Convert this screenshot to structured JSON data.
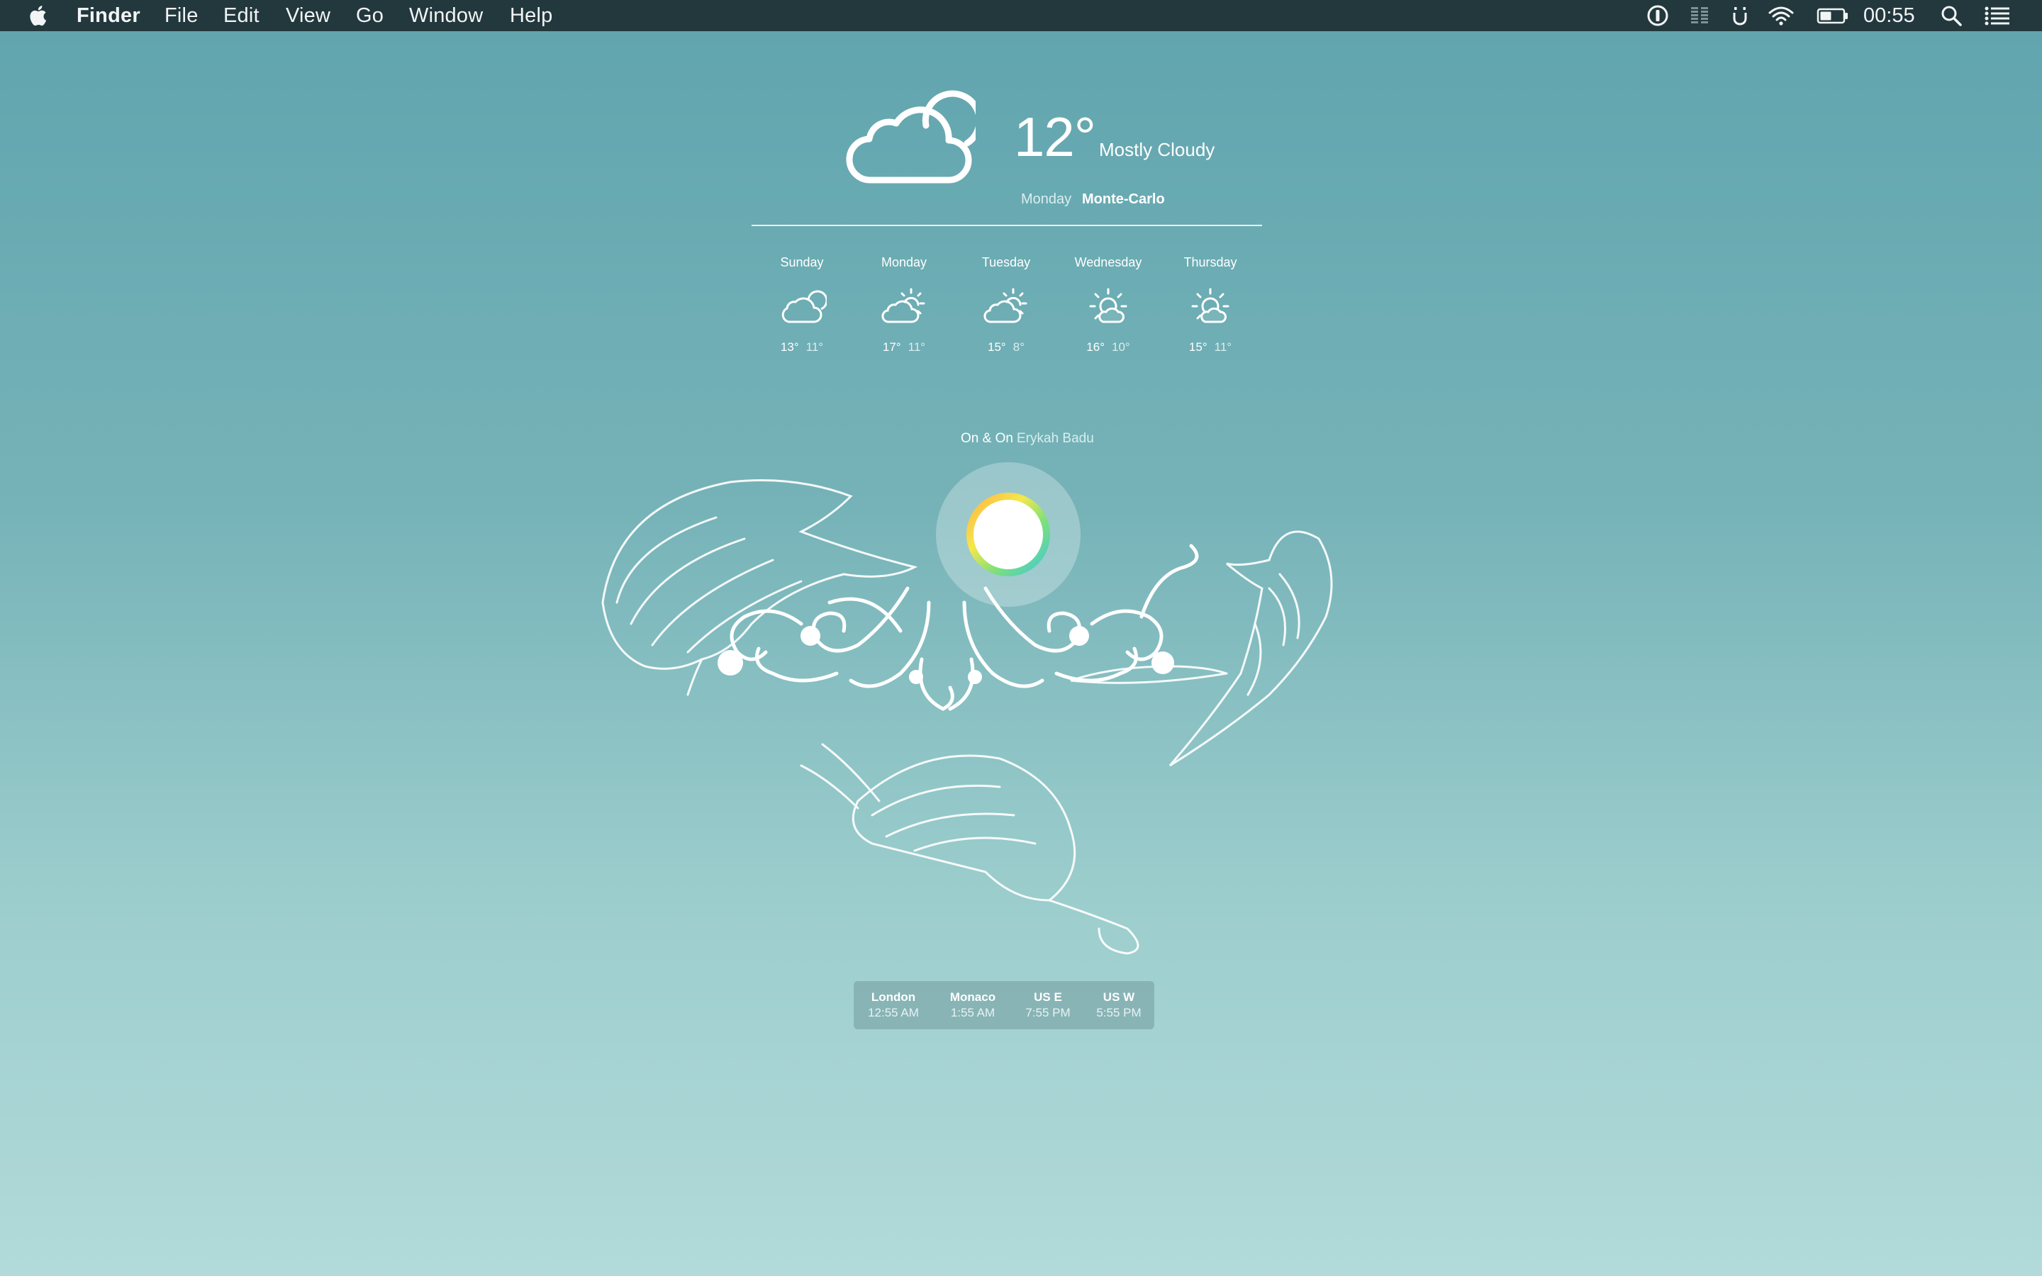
{
  "menubar": {
    "app_name": "Finder",
    "menus": [
      "File",
      "Edit",
      "View",
      "Go",
      "Window",
      "Help"
    ],
    "clock": "00:55",
    "tray_icons": [
      "onepassword-icon",
      "equalizer-icon",
      "unibox-icon",
      "wifi-icon",
      "battery-icon",
      "spotlight-icon",
      "notification-center-icon"
    ]
  },
  "weather": {
    "current": {
      "temp": "12°",
      "condition": "Mostly Cloudy",
      "day": "Monday",
      "city": "Monte-Carlo",
      "icon": "cloudy-icon"
    },
    "forecast": [
      {
        "day": "Sunday",
        "high": "13°",
        "low": "11°",
        "icon": "cloudy-icon"
      },
      {
        "day": "Monday",
        "high": "17°",
        "low": "11°",
        "icon": "partly-sunny-icon"
      },
      {
        "day": "Tuesday",
        "high": "15°",
        "low": "8°",
        "icon": "partly-sunny-icon"
      },
      {
        "day": "Wednesday",
        "high": "16°",
        "low": "10°",
        "icon": "mostly-sunny-icon"
      },
      {
        "day": "Thursday",
        "high": "15°",
        "low": "11°",
        "icon": "mostly-sunny-icon"
      }
    ]
  },
  "now_playing": {
    "song": "On & On",
    "artist": "Erykah Badu"
  },
  "world_clock": [
    {
      "city": "London",
      "time": "12:55 AM"
    },
    {
      "city": "Monaco",
      "time": "1:55 AM"
    },
    {
      "city": "US E",
      "time": "7:55 PM"
    },
    {
      "city": "US W",
      "time": "5:55 PM"
    }
  ]
}
